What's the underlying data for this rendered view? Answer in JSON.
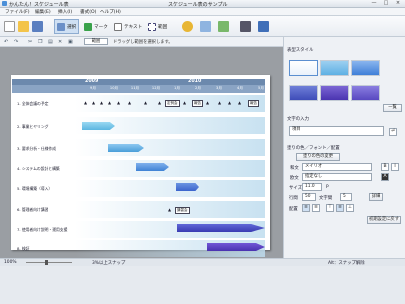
{
  "title_bar": {
    "left": "かんたん！スケジュール表",
    "center": "スケジュール表のサンプル",
    "min": "—",
    "max": "□",
    "close": "×"
  },
  "menu": [
    "ファイル(F)",
    "編集(E)",
    "挿入(I)",
    "書式(O)",
    "ヘルプ(H)"
  ],
  "toolbar": {
    "select_label": "選択",
    "mark_label": "マーク",
    "text_label": "テキスト",
    "range_label": "範囲"
  },
  "subbar": {
    "tag": "範囲",
    "hint": "ドラッグし範囲を選択します。"
  },
  "chart": {
    "years": [
      "2009",
      "2010"
    ],
    "months": [
      "9月",
      "10月",
      "11月",
      "12月",
      "1月",
      "2月",
      "3月",
      "4月",
      "5月"
    ],
    "rows": [
      "1. 全体会議の予定",
      "2. 事業ヒヤリング",
      "3. 要求分析・仕様作成",
      "4. システムの設計と構築",
      "5. 環境構築（導入）",
      "6. 管理者向け講習",
      "7. 使用者向け説明・運用支援",
      "8. 検証"
    ],
    "meeting_labels": [
      "定例会",
      "報告",
      "報告"
    ],
    "box6": "講習会"
  },
  "right_panel": {
    "style_title": "表型スタイル",
    "apply": "一覧",
    "text_input_title": "文字の入力",
    "text_value": "項目",
    "color_title": "塗りの色／フォント／配置",
    "fill_button": "塗りの色の変更",
    "font_label": "和文",
    "font_value": "メイリオ",
    "font2_label": "欧文",
    "font2_value": "指定なし",
    "size_label": "サイズ",
    "size_value": "11.0",
    "size_unit": "P",
    "spacing_label": "行間",
    "spacing_value": "50",
    "char_label": "文字間",
    "char_value": "5",
    "detail_button": "詳細",
    "align_label": "配置",
    "reset_button": "初期設定に戻す"
  },
  "status": {
    "zoom": "100%",
    "snap": "3%以上スナップ",
    "mode": "Alt：スナップ解除"
  },
  "colors": {
    "header": "#6c89ad",
    "month_row": "#8aa4c4",
    "cyan": "#6ec3e6",
    "blue": "#4a74d0",
    "purple": "#5a4fc4"
  }
}
